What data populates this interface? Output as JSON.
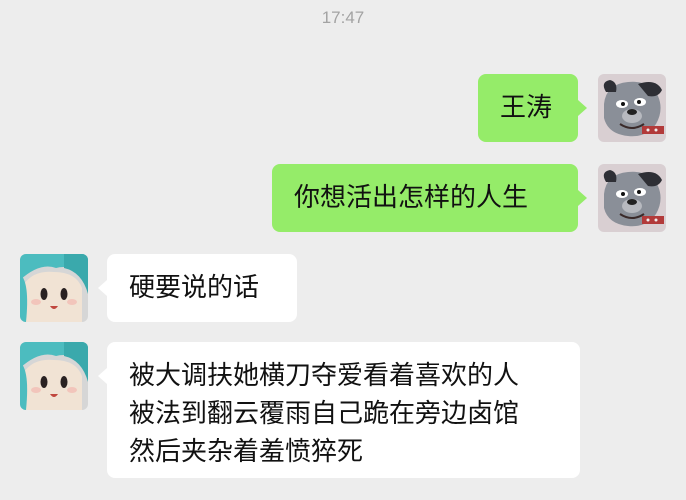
{
  "status": {
    "time": "17:47"
  },
  "messages": [
    {
      "side": "out",
      "text": "王涛",
      "avatar_icon": "bulldog-cartoon-avatar"
    },
    {
      "side": "out",
      "text": "你想活出怎样的人生",
      "avatar_icon": "bulldog-cartoon-avatar"
    },
    {
      "side": "in",
      "text": "硬要说的话",
      "avatar_icon": "anime-girl-avatar"
    },
    {
      "side": "in",
      "text": "被大调扶她横刀夺爱看着喜欢的人\n被法到翻云覆雨自己跪在旁边卤馆\n然后夹杂着羞愤猝死",
      "avatar_icon": "anime-girl-avatar"
    }
  ],
  "colors": {
    "outgoing_bubble": "#95ec69",
    "incoming_bubble": "#ffffff",
    "background": "#ededed"
  }
}
